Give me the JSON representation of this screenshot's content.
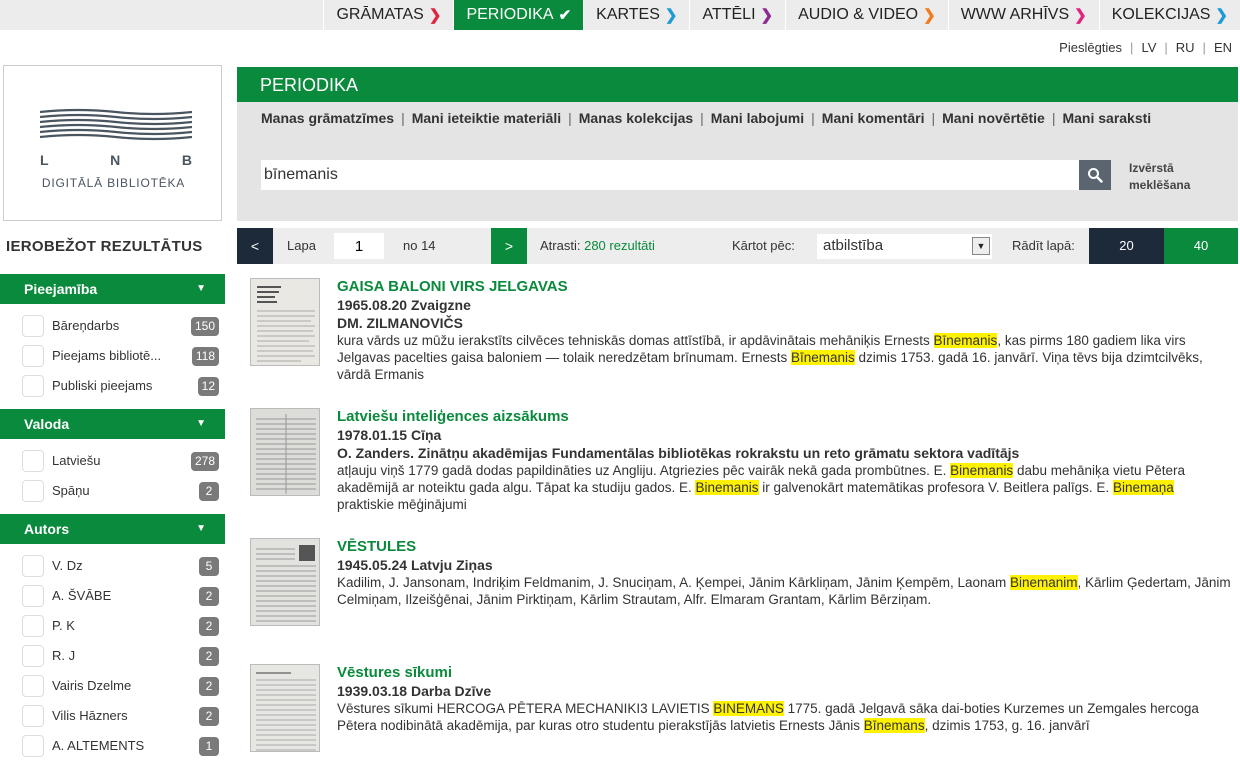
{
  "topnav": {
    "items": [
      {
        "label": "GRĀMATAS",
        "arrow": "❯",
        "color": "#e0243c"
      },
      {
        "label": "PERIODIKA",
        "arrow": "✔",
        "color": "#ffffff"
      },
      {
        "label": "KARTES",
        "arrow": "❯",
        "color": "#1e9ad6"
      },
      {
        "label": "ATTĒLI",
        "arrow": "❯",
        "color": "#8a2b8f"
      },
      {
        "label": "AUDIO & VIDEO",
        "arrow": "❯",
        "color": "#f07a1c"
      },
      {
        "label": "WWW ARHĪVS",
        "arrow": "❯",
        "color": "#e0247c"
      },
      {
        "label": "KOLEKCIJAS",
        "arrow": "❯",
        "color": "#1e9ad6"
      }
    ]
  },
  "userlinks": {
    "login": "Pieslēgties",
    "lv": "LV",
    "ru": "RU",
    "en": "EN",
    "sep": "|"
  },
  "logo": {
    "letters": [
      "L",
      "N",
      "B"
    ],
    "subtitle": "DIGITĀLĀ BIBLIOTĒKA"
  },
  "header": {
    "title": "PERIODIKA"
  },
  "sublinks": {
    "items": [
      "Manas grāmatzīmes",
      "Mani ieteiktie materiāli",
      "Manas kolekcijas",
      "Mani labojumi",
      "Mani komentāri",
      "Mani novērtētie",
      "Mani saraksti"
    ],
    "sep": "|"
  },
  "search": {
    "value": "bīnemanis",
    "advanced_line1": "Izvērstā",
    "advanced_line2": "meklēšana"
  },
  "facets": {
    "title": "IEROBEŽOT REZULTĀTUS",
    "groups": [
      {
        "title": "Pieejamība",
        "items": [
          {
            "label": "Bāreņdarbs",
            "count": "150"
          },
          {
            "label": "Pieejams bibliotē...",
            "count": "118"
          },
          {
            "label": "Publiski pieejams",
            "count": "12"
          }
        ]
      },
      {
        "title": "Valoda",
        "items": [
          {
            "label": "Latviešu",
            "count": "278"
          },
          {
            "label": "Spāņu",
            "count": "2"
          }
        ]
      },
      {
        "title": "Autors",
        "items": [
          {
            "label": "V. Dz",
            "count": "5"
          },
          {
            "label": "A. ŠVĀBE",
            "count": "2"
          },
          {
            "label": "P. K",
            "count": "2"
          },
          {
            "label": "R. J",
            "count": "2"
          },
          {
            "label": "Vairis Dzelme",
            "count": "2"
          },
          {
            "label": "Vilis Hāzners",
            "count": "2"
          },
          {
            "label": "A. ALTEMENTS",
            "count": "1"
          }
        ]
      }
    ]
  },
  "pager": {
    "prev": "<",
    "page_label": "Lapa",
    "page": "1",
    "of_label": "no 14",
    "next": ">",
    "found_label": "Atrasti:",
    "found_value": "280 rezultāti",
    "sort_label": "Kārtot pēc:",
    "sort_value": "atbilstība",
    "show_label": "Rādīt lapā:",
    "show_20": "20",
    "show_40": "40"
  },
  "results": [
    {
      "title": "GAISA BALONI VIRS JELGAVAS",
      "date_source": "1965.08.20 Zvaigzne",
      "author": "DM. ZILMANOVIČS",
      "snippet": [
        {
          "t": "kura vārds uz mūžu ierakstīts cilvēces tehniskās domas attīstībā, ir apdāvinātais mehāniķis Ernests "
        },
        {
          "t": "Bīnemanis",
          "hl": true
        },
        {
          "t": ", kas pirms 180 gadiem lika virs Jelgavas pacelties gaisa baloniem — tolaik neredzētam brīnumam. Ernests "
        },
        {
          "t": "Bīnemanis",
          "hl": true
        },
        {
          "t": " dzimis 1753. gadā 16. janvārī. Viņa tēvs bija dzimtcilvēks, vārdā Ermanis"
        }
      ]
    },
    {
      "title": "Latviešu inteliģences aizsākums",
      "date_source": "1978.01.15 Cīņa",
      "author": "O. Zanders. Zinātņu akadēmijas Fundamentālas bibliotēkas rokrakstu un reto grāmatu sektora vadītājs",
      "snippet": [
        {
          "t": "atļauju viņš 1779 gadā dodas papildināties uz Angliju. Atgriezies pēc vairāk nekā gada prombūtnes. E. "
        },
        {
          "t": "Binemanis",
          "hl": true
        },
        {
          "t": " dabu mehāniķa vietu Pētera akadēmijā ar noteiktu gada algu. Tāpat ka studiju gados. E. "
        },
        {
          "t": "Binemanis",
          "hl": true
        },
        {
          "t": " ir galvenokārt matemātikas profesora V. Beitlera palīgs. E. "
        },
        {
          "t": "Binemaņa",
          "hl": true
        },
        {
          "t": " praktiskie mēģinājumi"
        }
      ]
    },
    {
      "title": "VĒSTULES",
      "date_source": "1945.05.24 Latvju Ziņas",
      "author": "",
      "snippet": [
        {
          "t": "Kadilim, J. Jansonam, Indriķim Feldmanim, J. Snuciņam, A. Ķempei, Jānim Kārkliņam, Jānim Ķempēm, Laonam "
        },
        {
          "t": "Binemanim",
          "hl": true
        },
        {
          "t": ", Kārlim Ģedertam, Jānim Celmiņam, Ilzeišģēnai, Jānim Pirktiņam, Kārlim Strautam, Alfr. Elmaram Grantam, Kārlim Bērziņam."
        }
      ]
    },
    {
      "title": "Vēstures sīkumi",
      "date_source": "1939.03.18 Darba Dzīve",
      "author": "",
      "snippet": [
        {
          "t": "Vēstures sīkumi HERCOGA PĒTERA MECHANIKI3 LAVIETIS "
        },
        {
          "t": "BINEMANS",
          "hl": true
        },
        {
          "t": " 1775. gadā Jelgavā sāka dai-boties Kurzemes un Zemgales hercoga Pētera nodibinātā akadēmija, par kuras otro studentu pierakstījās latvietis Ernests Jānis "
        },
        {
          "t": "Bīnemans",
          "hl": true
        },
        {
          "t": ", dzimis 1753, g. 16. janvārī"
        }
      ]
    }
  ],
  "colors": {
    "brand_green": "#0a8a3c",
    "navy": "#1c2a3a",
    "highlight": "#fff200"
  }
}
